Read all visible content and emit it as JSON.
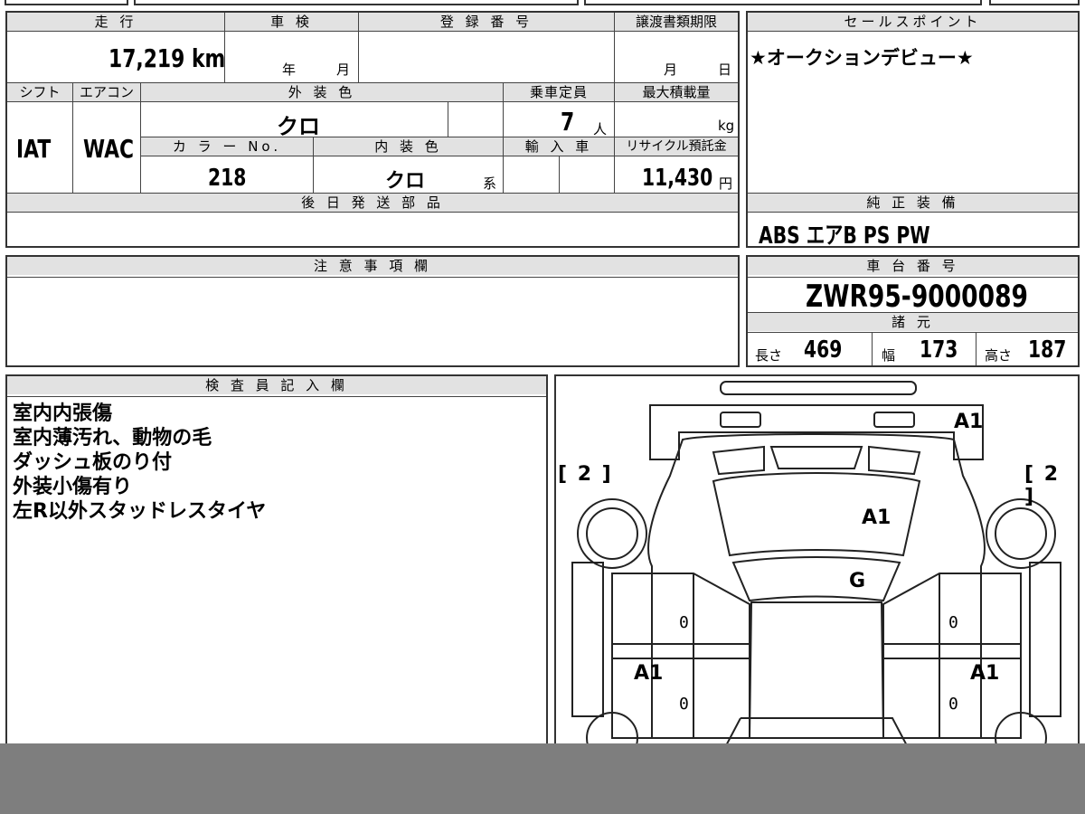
{
  "top_box": {
    "headers": {
      "mileage": "走 行",
      "inspection": "車 検",
      "registration": "登 録 番 号",
      "transfer_deadline": "譲渡書類期限",
      "shift": "シフト",
      "aircon": "エアコン",
      "exterior_color": "外 装 色",
      "capacity": "乗車定員",
      "max_load": "最大積載量",
      "color_no": "カ ラ ー No.",
      "interior_color": "内 装 色",
      "import": "輸 入 車",
      "recycle": "リサイクル預託金"
    },
    "mileage_value": "17,219",
    "mileage_unit": "km",
    "inspection_year_unit": "年",
    "inspection_month_unit": "月",
    "transfer_month_unit": "月",
    "transfer_day_unit": "日",
    "shift_value": "IAT",
    "aircon_value": "WAC",
    "exterior_color_value": "クロ",
    "capacity_value": "7",
    "capacity_unit": "人",
    "max_load_unit": "kg",
    "color_no_value": "218",
    "interior_color_value": "クロ",
    "interior_color_suffix": "系",
    "recycle_value": "11,430",
    "recycle_unit": "円"
  },
  "later_parts": {
    "header": "後 日 発 送 部 品"
  },
  "sales_point": {
    "header": "セールスポイント",
    "text": "★オークションデビュー★"
  },
  "genuine_equipment": {
    "header": "純 正 装 備",
    "value": "ABS エアB PS PW"
  },
  "notes_box": {
    "header": "注 意 事 項 欄"
  },
  "chassis": {
    "header": "車 台 番 号",
    "value": "ZWR95-9000089"
  },
  "specs": {
    "header": "諸 元",
    "length_label": "長さ",
    "length_value": "469",
    "width_label": "幅",
    "width_value": "173",
    "height_label": "高さ",
    "height_value": "187"
  },
  "inspector": {
    "header": "検 査 員 記 入 欄",
    "lines": [
      "室内内張傷",
      "室内薄汚れ、動物の毛",
      "ダッシュ板のり付",
      "外装小傷有り",
      "左R以外スタッドレスタイヤ"
    ]
  },
  "diagram": {
    "rear_mark": "A1",
    "windshield_mark": "A1",
    "roof_mark": "G",
    "left_door_mark": "A1",
    "right_door_mark": "A1",
    "left_tire_mark": "[ 2 ]",
    "right_tire_mark": "[ 2 ]",
    "zero_mark": "0"
  }
}
